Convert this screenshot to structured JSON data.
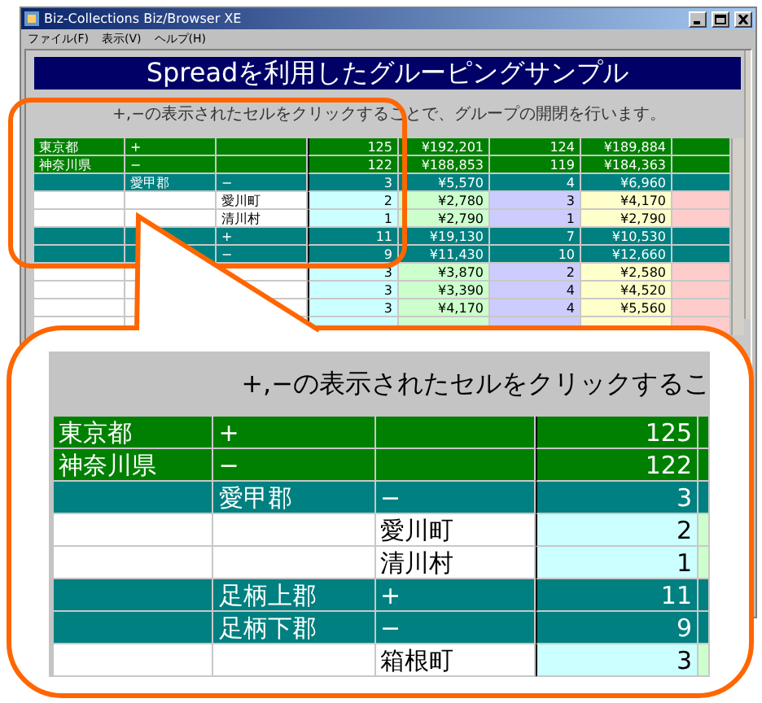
{
  "window": {
    "title": "Biz-Collections Biz/Browser XE"
  },
  "menu": [
    "ファイル(F)",
    "表示(V)",
    "ヘルプ(H)"
  ],
  "page": {
    "heading": "Spreadを利用したグルーピングサンプル",
    "instruction": "+,−の表示されたセルをクリックすることで、グループの開閉を行います。"
  },
  "table": {
    "rows": [
      {
        "kind": "prefecture",
        "cells": [
          "東京都",
          "+",
          null,
          "125",
          "¥192,201",
          "124",
          "¥189,884"
        ]
      },
      {
        "kind": "prefecture",
        "cells": [
          "神奈川県",
          "−",
          null,
          "122",
          "¥188,853",
          "119",
          "¥184,363"
        ]
      },
      {
        "kind": "district",
        "cells": [
          null,
          "愛甲郡",
          "−",
          "3",
          "¥5,570",
          "4",
          "¥6,960"
        ]
      },
      {
        "kind": "town",
        "cells": [
          null,
          null,
          "愛川町",
          "2",
          "¥2,780",
          "3",
          "¥4,170"
        ]
      },
      {
        "kind": "town",
        "cells": [
          null,
          null,
          "清川村",
          "1",
          "¥2,790",
          "1",
          "¥2,790"
        ]
      },
      {
        "kind": "district",
        "cells": [
          null,
          null,
          "+",
          "11",
          "¥19,130",
          "7",
          "¥10,530"
        ]
      },
      {
        "kind": "district",
        "cells": [
          null,
          null,
          "−",
          "9",
          "¥11,430",
          "10",
          "¥12,660"
        ]
      },
      {
        "kind": "town",
        "cells": [
          null,
          null,
          null,
          "3",
          "¥3,870",
          "2",
          "¥2,580"
        ]
      },
      {
        "kind": "town",
        "cells": [
          null,
          null,
          null,
          "3",
          "¥3,390",
          "4",
          "¥4,520"
        ]
      },
      {
        "kind": "town",
        "cells": [
          null,
          null,
          null,
          "3",
          "¥4,170",
          "4",
          "¥5,560"
        ]
      },
      {
        "kind": "town",
        "cells": [
          null,
          null,
          null,
          null,
          null,
          null,
          null
        ]
      }
    ]
  },
  "callout": {
    "instruction": "+,−の表示されたセルをクリックするこ",
    "rows": [
      {
        "kind": "prefecture",
        "cells": [
          "東京都",
          "+",
          null,
          "125"
        ]
      },
      {
        "kind": "prefecture",
        "cells": [
          "神奈川県",
          "−",
          null,
          "122"
        ]
      },
      {
        "kind": "district",
        "cells": [
          null,
          "愛甲郡",
          "−",
          "3"
        ]
      },
      {
        "kind": "town",
        "cells": [
          null,
          null,
          "愛川町",
          "2"
        ]
      },
      {
        "kind": "town",
        "cells": [
          null,
          null,
          "清川村",
          "1"
        ]
      },
      {
        "kind": "district",
        "cells": [
          null,
          "足柄上郡",
          "+",
          "11"
        ]
      },
      {
        "kind": "district",
        "cells": [
          null,
          "足柄下郡",
          "−",
          "9"
        ]
      },
      {
        "kind": "town",
        "cells": [
          null,
          null,
          "箱根町",
          "3"
        ]
      }
    ]
  }
}
